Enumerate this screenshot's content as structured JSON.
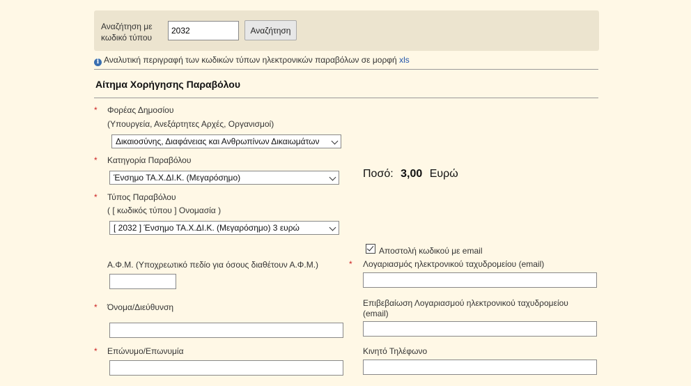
{
  "search": {
    "label": "Αναζήτηση με κωδικό τύπου",
    "input_value": "2032",
    "button_label": "Αναζήτηση"
  },
  "info": {
    "text": "Αναλυτική περιγραφή των κωδικών τύπων ηλεκτρονικών παραβόλων σε μορφή",
    "link": "xls"
  },
  "form": {
    "title": "Αίτημα Χορήγησης Παραβόλου",
    "required_mark": "*",
    "public_body": {
      "label": "Φορέας Δημοσίου",
      "sublabel": "(Υπουργεία, Ανεξάρτητες Αρχές, Οργανισμοί)",
      "selected": "Δικαιοσύνης, Διαφάνειας και Ανθρωπίνων Δικαιωμάτων"
    },
    "category": {
      "label": "Κατηγορία Παραβόλου",
      "selected": "Ένσημο ΤΑ.Χ.ΔΙ.Κ. (Μεγαρόσημο)"
    },
    "amount": {
      "label": "Ποσό:",
      "value": "3,00",
      "currency": "Ευρώ"
    },
    "type": {
      "label": "Τύπος Παραβόλου",
      "sublabel": "( [ κωδικός τύπου ] Ονομασία )",
      "selected": "[ 2032 ] Ένσημο ΤΑ.Χ.ΔΙ.Κ. (Μεγαρόσημο) 3 ευρώ"
    },
    "send_code_email": {
      "label": "Αποστολή κωδικού με email",
      "checked": true
    },
    "afm": {
      "label": "Α.Φ.Μ. (Υποχρεωτικό πεδίο για όσους διαθέτουν Α.Φ.Μ.)",
      "value": ""
    },
    "email": {
      "label": "Λογαριασμός ηλεκτρονικού ταχυδρομείου (email)",
      "value": ""
    },
    "name_address": {
      "label": "Όνομα/Διεύθυνση",
      "value": ""
    },
    "email_confirm": {
      "label": "Επιβεβαίωση Λογαριασμού ηλεκτρονικού ταχυδρομείου (email)",
      "value": ""
    },
    "surname": {
      "label": "Επώνυμο/Επωνυμία",
      "value": ""
    },
    "mobile": {
      "label": "Κινητό Τηλέφωνο",
      "value": ""
    }
  }
}
